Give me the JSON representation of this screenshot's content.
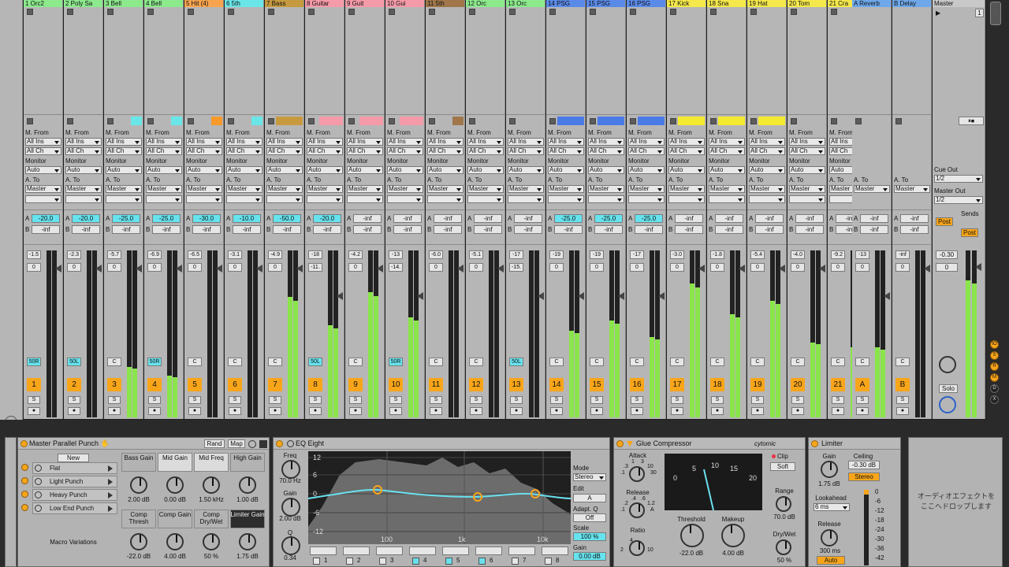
{
  "tracks": [
    {
      "name": "1 Orc2",
      "color": "#8ce98c",
      "send_a": "-20.0",
      "send_b": "-inf",
      "vol": "-1.5",
      "peak": "0",
      "pan": "50R",
      "num": "1",
      "lvl": 0,
      "clip": null
    },
    {
      "name": "2 Poly Sa",
      "color": "#8ce98c",
      "send_a": "-20.0",
      "send_b": "-inf",
      "vol": "-2.3",
      "peak": "0",
      "pan": "50L",
      "num": "2",
      "lvl": 0,
      "clip": null
    },
    {
      "name": "3 Bell",
      "color": "#8ce98c",
      "send_a": "-25.0",
      "send_b": "-inf",
      "vol": "-5.7",
      "peak": "0",
      "pan": "C",
      "num": "3",
      "lvl": 0.3,
      "clip": "#6ae6e8"
    },
    {
      "name": "4 Bell",
      "color": "#8ce98c",
      "send_a": "-25.0",
      "send_b": "-inf",
      "vol": "-6.9",
      "peak": "0",
      "pan": "50R",
      "num": "4",
      "lvl": 0.25,
      "clip": "#6ae6e8"
    },
    {
      "name": "5 Hit (4)",
      "color": "#f8a44e",
      "send_a": "-30.0",
      "send_b": "-inf",
      "vol": "-6.5",
      "peak": "0",
      "pan": "C",
      "num": "5",
      "lvl": 0,
      "clip": "#f89a2a"
    },
    {
      "name": "6 5th",
      "color": "#6ae6e8",
      "send_a": "-10.0",
      "send_b": "-inf",
      "vol": "-3.1",
      "peak": "0",
      "pan": "C",
      "num": "6",
      "lvl": 0,
      "clip": "#6ae6e8"
    },
    {
      "name": "7 Bass",
      "color": "#c59a3e",
      "send_a": "-50.0",
      "send_b": "-inf",
      "vol": "-4.9",
      "peak": "0",
      "pan": "C",
      "num": "7",
      "lvl": 0.72,
      "clip": "#c89a40"
    },
    {
      "name": "8 Guitar",
      "color": "#f59aa8",
      "send_a": "-20.0",
      "send_b": "-inf",
      "vol": "-18",
      "peak": "-11.",
      "pan": "50L",
      "num": "8",
      "lvl": 0.55,
      "clip": "#f59aa8"
    },
    {
      "name": "9 Guit",
      "color": "#f59aa8",
      "send_a": "-inf",
      "send_b": "-inf",
      "vol": "-4.2",
      "peak": "0",
      "pan": "C",
      "num": "9",
      "lvl": 0.75,
      "clip": "#f59aa8"
    },
    {
      "name": "10 Gui",
      "color": "#f59aa8",
      "send_a": "-inf",
      "send_b": "-inf",
      "vol": "-13",
      "peak": "-14.",
      "pan": "50R",
      "num": "10",
      "lvl": 0.6,
      "clip": "#f59aa8"
    },
    {
      "name": "11 5th",
      "color": "#a0764a",
      "send_a": "-inf",
      "send_b": "-inf",
      "vol": "-6.0",
      "peak": "0",
      "pan": "C",
      "num": "11",
      "lvl": 0,
      "clip": "#a0764a"
    },
    {
      "name": "12 Orc",
      "color": "#8ce98c",
      "send_a": "-inf",
      "send_b": "-inf",
      "vol": "-5.1",
      "peak": "0",
      "pan": "C",
      "num": "12",
      "lvl": 0,
      "clip": null
    },
    {
      "name": "13 Orc",
      "color": "#8ce98c",
      "send_a": "-inf",
      "send_b": "-inf",
      "vol": "-17",
      "peak": "-15.",
      "pan": "50L",
      "num": "13",
      "lvl": 0,
      "clip": null
    },
    {
      "name": "14 PSG",
      "color": "#5a8ae8",
      "send_a": "-25.0",
      "send_b": "-inf",
      "vol": "-19",
      "peak": "0",
      "pan": "C",
      "num": "14",
      "lvl": 0.52,
      "clip": "#4a7ae6"
    },
    {
      "name": "15 PSG",
      "color": "#5a8ae8",
      "send_a": "-25.0",
      "send_b": "-inf",
      "vol": "-19",
      "peak": "0",
      "pan": "C",
      "num": "15",
      "lvl": 0.58,
      "clip": "#4a7ae6"
    },
    {
      "name": "16 PSG",
      "color": "#5a8ae8",
      "send_a": "-25.0",
      "send_b": "-inf",
      "vol": "-17",
      "peak": "0",
      "pan": "C",
      "num": "16",
      "lvl": 0.48,
      "clip": "#4a7ae6"
    },
    {
      "name": "17 Kick",
      "color": "#f4e84a",
      "send_a": "-inf",
      "send_b": "-inf",
      "vol": "-3.0",
      "peak": "0",
      "pan": "C",
      "num": "17",
      "lvl": 0.8,
      "clip": "#f4ea30"
    },
    {
      "name": "18 Sna",
      "color": "#f4e84a",
      "send_a": "-inf",
      "send_b": "-inf",
      "vol": "-1.8",
      "peak": "0",
      "pan": "C",
      "num": "18",
      "lvl": 0.62,
      "clip": "#f4ea30"
    },
    {
      "name": "19 Hat",
      "color": "#f4e84a",
      "send_a": "-inf",
      "send_b": "-inf",
      "vol": "-5.4",
      "peak": "0",
      "pan": "C",
      "num": "19",
      "lvl": 0.7,
      "clip": "#f4ea30"
    },
    {
      "name": "20 Tom",
      "color": "#f4e84a",
      "send_a": "-inf",
      "send_b": "-inf",
      "vol": "-4.0",
      "peak": "0",
      "pan": "C",
      "num": "20",
      "lvl": 0.45,
      "clip": null
    },
    {
      "name": "21 Cra",
      "color": "#f4e84a",
      "send_a": "-inf",
      "send_b": "-inf",
      "vol": "-9.2",
      "peak": "0",
      "pan": "C",
      "num": "21",
      "lvl": 0.42,
      "clip": "#f4ea30"
    }
  ],
  "returns": [
    {
      "name": "A Reverb",
      "color": "#6ea8ea",
      "send_a": "-inf",
      "send_b": "-inf",
      "vol": "-13",
      "peak": "0",
      "pan": "C",
      "num": "A",
      "lvl": 0.42
    },
    {
      "name": "B Delay",
      "color": "#6ea8ea",
      "send_a": "-inf",
      "send_b": "-inf",
      "vol": "-inf",
      "peak": "0",
      "pan": "C",
      "num": "B",
      "lvl": 0
    }
  ],
  "master": {
    "name": "Master",
    "scene": "1",
    "cue_out_label": "Cue Out",
    "cue_out": "1/2",
    "master_out_label": "Master Out",
    "master_out": "1/2",
    "sends_label": "Sends",
    "post": "Post",
    "vol": "-0.30",
    "peak": "0",
    "solo": "Solo",
    "lvl": 0.82
  },
  "routing": {
    "midi_from": "M. From",
    "all_ins": "All Ins",
    "all_ch": "All Ch",
    "monitor": "Monitor",
    "auto": "Auto",
    "audio_to": "A. To",
    "master": "Master",
    "track_a": "A",
    "track_b": "B",
    "solo_s": "S"
  },
  "side_letters": [
    "IO",
    "S",
    "R",
    "M",
    "D",
    "X"
  ],
  "rack": {
    "title": "Master Parallel Punch",
    "rand": "Rand",
    "map": "Map",
    "new": "New",
    "presets": [
      "Flat",
      "Light Punch",
      "Heavy Punch",
      "Low End Punch"
    ],
    "variations": "Macro Variations",
    "macros": [
      {
        "label": "Bass Gain",
        "value": "2.00 dB"
      },
      {
        "label": "Mid Gain",
        "value": "0.00 dB"
      },
      {
        "label": "Mid Freq",
        "value": "1.50 kHz"
      },
      {
        "label": "High Gain",
        "value": "1.00 dB"
      },
      {
        "label": "Comp Thresh",
        "value": "-22.0 dB"
      },
      {
        "label": "Comp Gain",
        "value": "4.00 dB"
      },
      {
        "label": "Comp Dry/Wet",
        "value": "50 %"
      },
      {
        "label": "Limiter Gain",
        "value": "1.75 dB"
      }
    ]
  },
  "eq": {
    "title": "EQ Eight",
    "freq_label": "Freq",
    "freq": "70.0 Hz",
    "gain_label": "Gain",
    "gain": "2.00 dB",
    "q_label": "Q",
    "q": "0.34",
    "mode_label": "Mode",
    "mode": "Stereo",
    "edit": "Edit",
    "edit_val": "A",
    "adapt_label": "Adapt. Q",
    "adapt": "Off",
    "scale_label": "Scale",
    "scale": "100 %",
    "out_gain_label": "Gain",
    "out_gain": "0.00 dB",
    "y_ticks": [
      "12",
      "6",
      "0",
      "-6",
      "-12"
    ],
    "x_ticks": [
      "100",
      "1k",
      "10k"
    ],
    "bands": [
      "1",
      "2",
      "3",
      "4",
      "5",
      "6",
      "7",
      "8"
    ]
  },
  "glue": {
    "title": "Glue Compressor",
    "brand": "cytomic",
    "attack_label": "Attack",
    "attack_ticks": [
      ".1",
      ".3",
      "1",
      "3",
      "10",
      "30"
    ],
    "release_label": "Release",
    "release_ticks": [
      ".1",
      ".2",
      ".4",
      ".6",
      "1.2",
      "A"
    ],
    "ratio_label": "Ratio",
    "ratio_ticks": [
      "2",
      "4",
      "10"
    ],
    "threshold_label": "Threshold",
    "threshold": "-22.0 dB",
    "makeup_label": "Makeup",
    "makeup": "4.00 dB",
    "clip_label": "Clip",
    "soft": "Soft",
    "range_label": "Range",
    "range": "70.0 dB",
    "drywet_label": "Dry/Wet",
    "drywet": "50 %",
    "vu_ticks": [
      "0",
      "5",
      "10",
      "15",
      "20"
    ]
  },
  "limiter": {
    "title": "Limiter",
    "gain_label": "Gain",
    "gain": "1.75 dB",
    "ceiling_label": "Ceiling",
    "ceiling": "-0.30 dB",
    "stereo": "Stereo",
    "lookahead_label": "Lookahead",
    "lookahead": "6 ms",
    "release_label": "Release",
    "release": "300 ms",
    "auto": "Auto",
    "scale": [
      "0",
      "-6",
      "-12",
      "-18",
      "-24",
      "-30",
      "-36",
      "-42"
    ]
  },
  "drop_hint": "オーディオエフェクトを\nここへドロップします"
}
